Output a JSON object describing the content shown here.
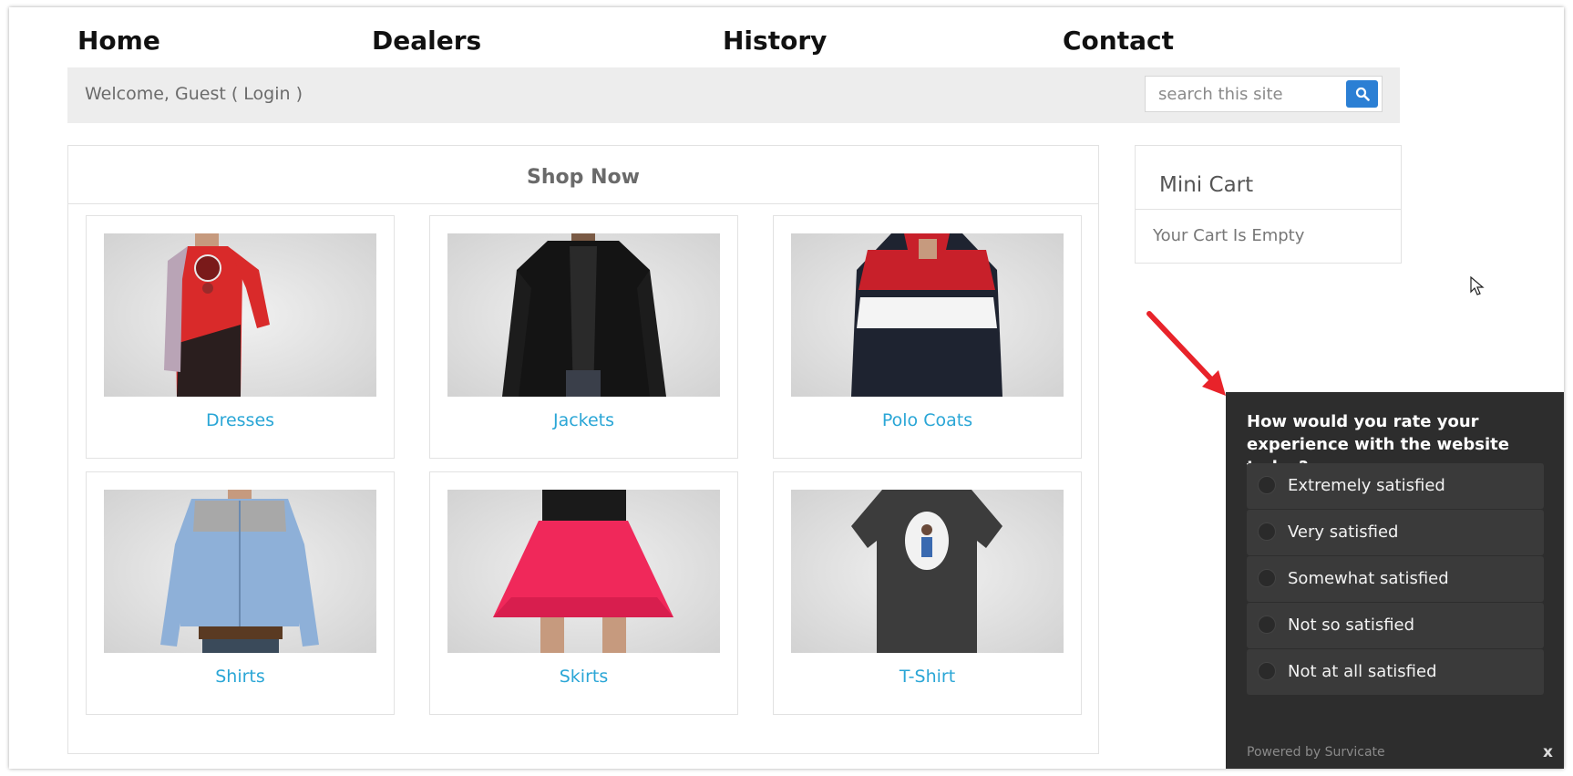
{
  "nav": {
    "items": [
      "Home",
      "Dealers",
      "History",
      "Contact"
    ]
  },
  "welcome_bar": {
    "welcome_text": "Welcome, Guest ( Login )",
    "search_placeholder": "search this site"
  },
  "shop": {
    "title": "Shop Now",
    "categories": [
      "Dresses",
      "Jackets",
      "Polo Coats",
      "Shirts",
      "Skirts",
      "T-Shirt"
    ]
  },
  "mini_cart": {
    "title": "Mini Cart",
    "empty_text": "Your Cart Is Empty"
  },
  "survey": {
    "question": "How would you rate your experience with the website today?",
    "options": [
      "Extremely satisfied",
      "Very satisfied",
      "Somewhat satisfied",
      "Not so satisfied",
      "Not at all satisfied"
    ],
    "powered_by": "Powered by Survicate",
    "close_label": "x"
  },
  "colors": {
    "accent_blue": "#2b7fd4",
    "link_cyan": "#2aa6d6",
    "survey_bg": "#2d2d2d",
    "arrow_red": "#e8232a"
  }
}
